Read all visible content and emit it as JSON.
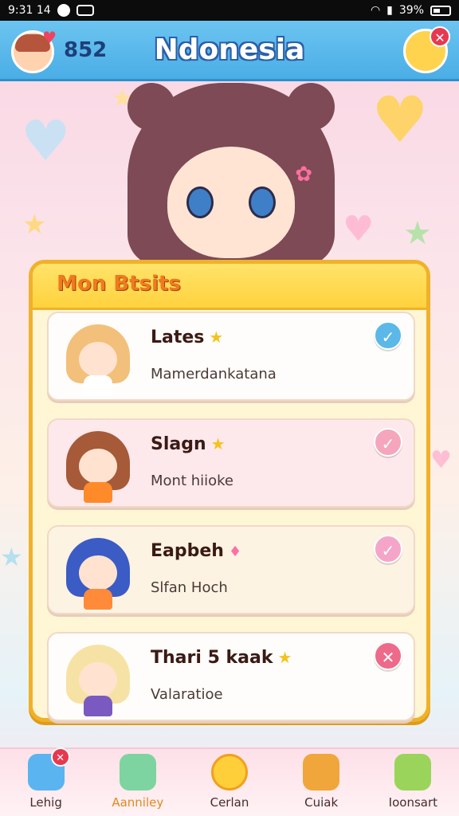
{
  "status_bar": {
    "time": "9:31 14",
    "battery": "39%"
  },
  "header": {
    "count": "852",
    "title": "Ndonesia",
    "notification_badge": "✕"
  },
  "panel": {
    "title": "Mon Btsits"
  },
  "items": [
    {
      "name": "Lates",
      "subtitle": "Mamerdankatana",
      "action": "✓",
      "action_color": "#5cb8e8",
      "tag": "★",
      "hair_color": "#f2c07a",
      "outfit_color": "#ffffff"
    },
    {
      "name": "Slagn",
      "subtitle": "Mont hiioke",
      "action": "✓",
      "action_color": "#f5a6bd",
      "tag": "★",
      "hair_color": "#a65a38",
      "outfit_color": "#ff8a2a"
    },
    {
      "name": "Eapbeh",
      "subtitle": "Slfan Hoch",
      "action": "✓",
      "action_color": "#f5a6c8",
      "tag": "♦",
      "hair_color": "#3b5cc4",
      "outfit_color": "#ff8a3a"
    },
    {
      "name": "Thari 5 kaak",
      "subtitle": "Valaratioe",
      "action": "✕",
      "action_color": "#ee6a8a",
      "tag": "★",
      "hair_color": "#f6e2a4",
      "outfit_color": "#7a5ac0"
    }
  ],
  "nav": [
    {
      "label": "Lehig",
      "icon": "home-icon",
      "color": "#5ab4f0",
      "badge": "✕"
    },
    {
      "label": "Aanniley",
      "icon": "gem-icon",
      "color": "#7ed4a0",
      "badge": ""
    },
    {
      "label": "Cerlan",
      "icon": "calendar-icon",
      "color": "#ffcf3a",
      "badge": ""
    },
    {
      "label": "Cuiak",
      "icon": "bear-icon",
      "color": "#f0a63a",
      "badge": ""
    },
    {
      "label": "Ioonsart",
      "icon": "frog-icon",
      "color": "#9ad45a",
      "badge": ""
    }
  ]
}
